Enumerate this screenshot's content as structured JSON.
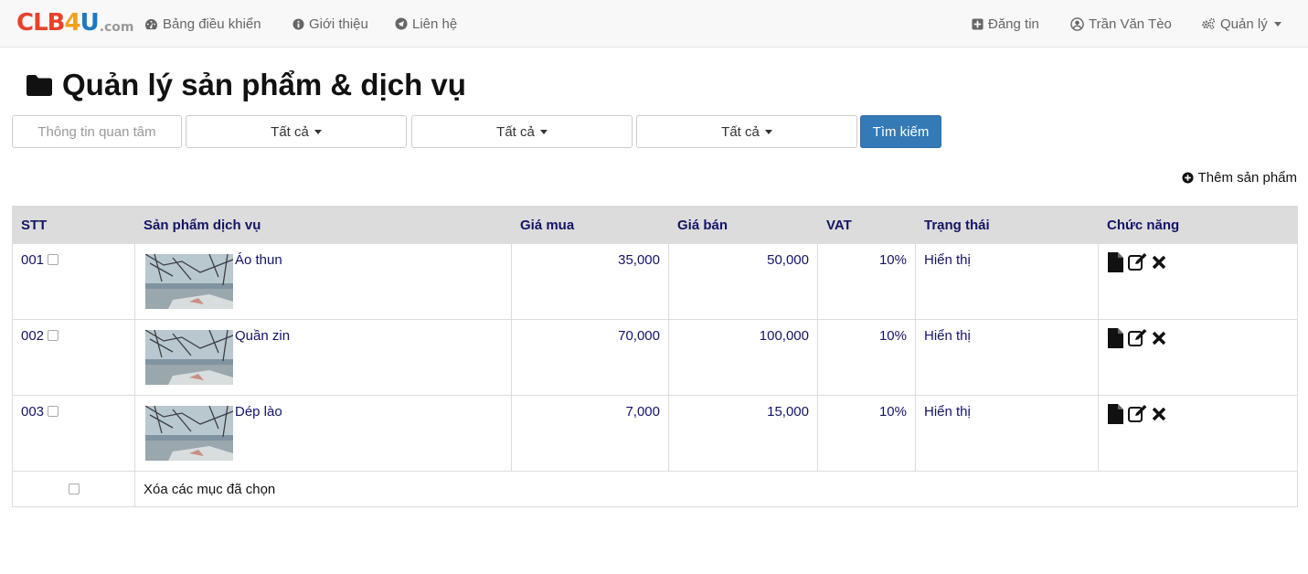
{
  "navbar": {
    "logo": {
      "part1": "CLB",
      "part2": "4",
      "part3": "U",
      "suffix": ".com"
    },
    "left_items": [
      {
        "label": "Bảng điều khiển",
        "icon": "dashboard-icon"
      },
      {
        "label": "Giới thiệu",
        "icon": "info-icon"
      },
      {
        "label": "Liên hệ",
        "icon": "send-icon"
      }
    ],
    "right_items": [
      {
        "label": "Đăng tin",
        "icon": "plus-square-icon"
      },
      {
        "label": "Trần Văn Tèo",
        "icon": "user-icon"
      },
      {
        "label": "Quản lý",
        "icon": "cogs-icon"
      }
    ]
  },
  "page": {
    "title": "Quản lý sản phẩm & dịch vụ"
  },
  "filters": {
    "search_placeholder": "Thông tin quan tâm",
    "dropdowns": [
      "Tất cả",
      "Tất cả",
      "Tất cả"
    ],
    "search_button": "Tìm kiếm"
  },
  "add_product_label": "Thêm sản phẩm",
  "table": {
    "headers": [
      "STT",
      "Sản phẩm dịch vụ",
      "Giá mua",
      "Giá bán",
      "VAT",
      "Trạng thái",
      "Chức năng"
    ],
    "rows": [
      {
        "stt": "001",
        "name": "Áo thun",
        "buy": "35,000",
        "sell": "50,000",
        "vat": "10%",
        "status": "Hiển thị"
      },
      {
        "stt": "002",
        "name": "Quần zin",
        "buy": "70,000",
        "sell": "100,000",
        "vat": "10%",
        "status": "Hiển thị"
      },
      {
        "stt": "003",
        "name": "Dép lào",
        "buy": "7,000",
        "sell": "15,000",
        "vat": "10%",
        "status": "Hiển thị"
      }
    ],
    "delete_selected": "Xóa các mục đã chọn"
  },
  "colors": {
    "primary": "#337ab7",
    "header_text": "#141466",
    "navbar_bg": "#f8f8f8"
  }
}
